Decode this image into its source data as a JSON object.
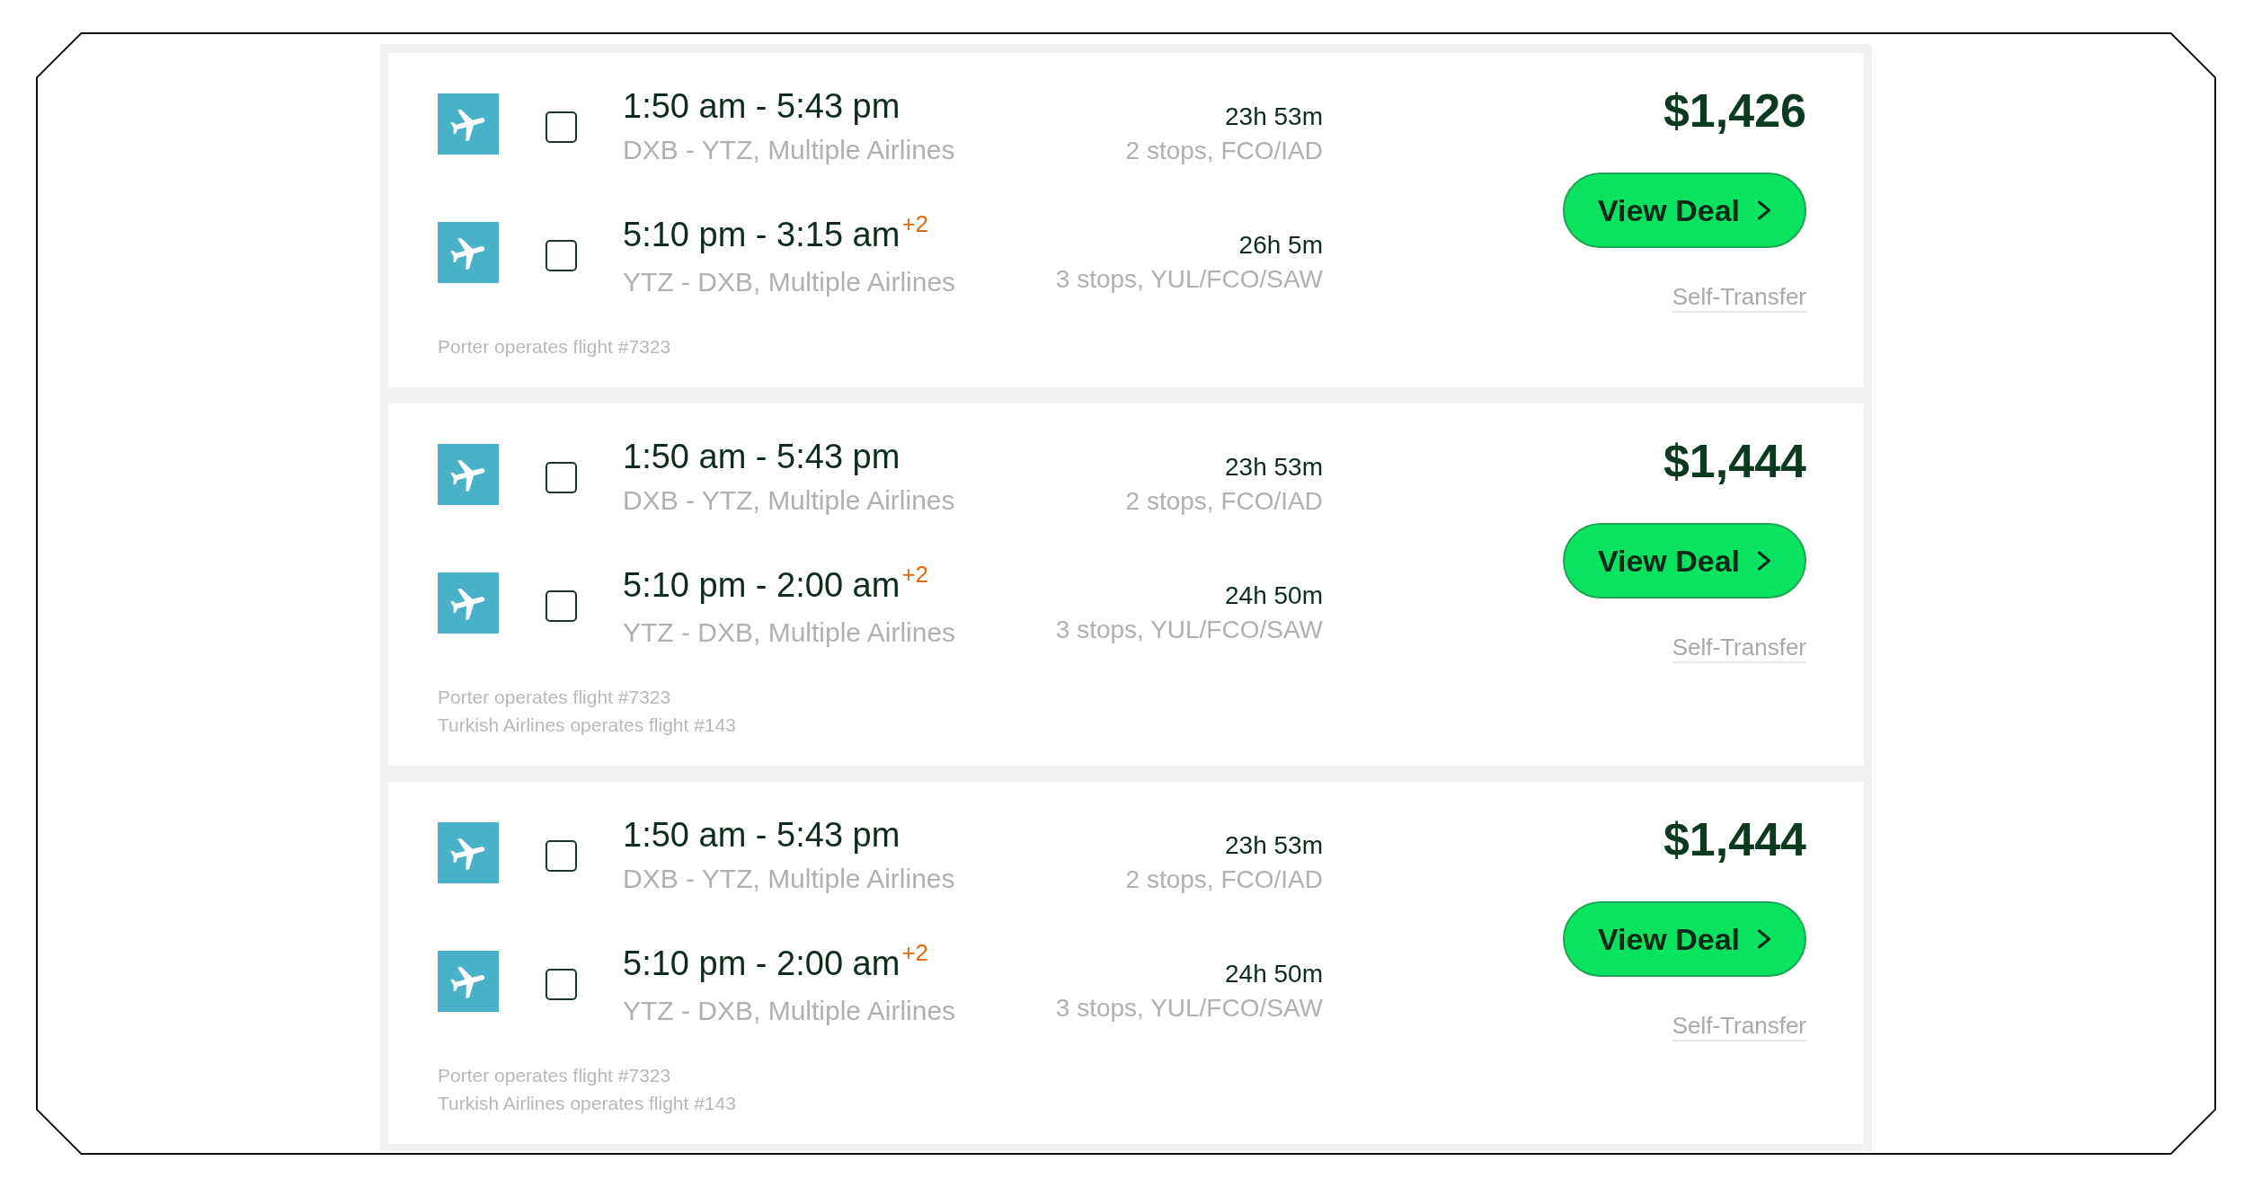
{
  "results": [
    {
      "legs": [
        {
          "times": "1:50 am - 5:43 pm",
          "route": "DXB - YTZ, Multiple Airlines",
          "duration": "23h 53m",
          "stops": "2 stops, FCO/IAD",
          "checked": false
        },
        {
          "times": "5:10 pm - 3:15 am",
          "day_offset": "+2",
          "route": "YTZ - DXB, Multiple Airlines",
          "duration": "26h 5m",
          "stops": "3 stops, YUL/FCO/SAW",
          "checked": false
        }
      ],
      "notes": [
        "Porter operates flight #7323"
      ],
      "price": "$1,426",
      "button": "View Deal",
      "tag": "Self-Transfer"
    },
    {
      "legs": [
        {
          "times": "1:50 am - 5:43 pm",
          "route": "DXB - YTZ, Multiple Airlines",
          "duration": "23h 53m",
          "stops": "2 stops, FCO/IAD",
          "checked": false
        },
        {
          "times": "5:10 pm - 2:00 am",
          "day_offset": "+2",
          "route": "YTZ - DXB, Multiple Airlines",
          "duration": "24h 50m",
          "stops": "3 stops, YUL/FCO/SAW",
          "checked": false
        }
      ],
      "notes": [
        "Porter operates flight #7323",
        "Turkish Airlines operates flight #143"
      ],
      "price": "$1,444",
      "button": "View Deal",
      "tag": "Self-Transfer"
    },
    {
      "legs": [
        {
          "times": "1:50 am - 5:43 pm",
          "route": "DXB - YTZ, Multiple Airlines",
          "duration": "23h 53m",
          "stops": "2 stops, FCO/IAD",
          "checked": false
        },
        {
          "times": "5:10 pm - 2:00 am",
          "day_offset": "+2",
          "route": "YTZ - DXB, Multiple Airlines",
          "duration": "24h 50m",
          "stops": "3 stops, YUL/FCO/SAW",
          "checked": false
        }
      ],
      "notes": [
        "Porter operates flight #7323",
        "Turkish Airlines operates flight #143"
      ],
      "price": "$1,444",
      "button": "View Deal",
      "tag": "Self-Transfer"
    }
  ]
}
